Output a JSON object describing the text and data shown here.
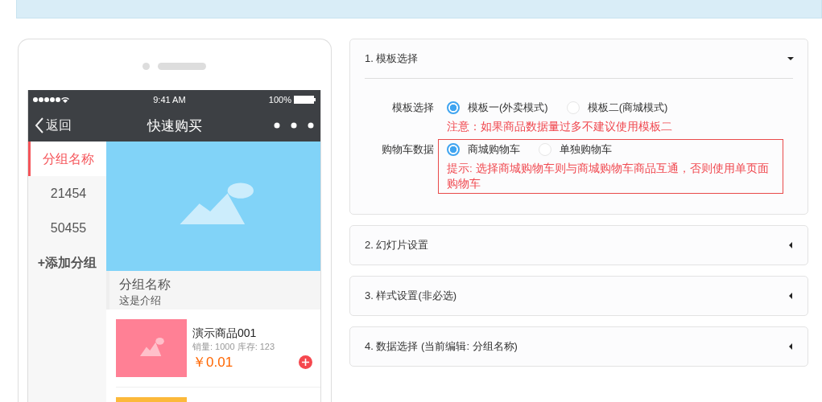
{
  "phone": {
    "status_bar": {
      "time": "9:41 AM",
      "battery": "100%"
    },
    "nav": {
      "back": "返回",
      "title": "快速购买"
    },
    "sidebar": {
      "items": [
        {
          "label": "分组名称",
          "selected": true
        },
        {
          "label": "21454",
          "selected": false
        },
        {
          "label": "50455",
          "selected": false
        }
      ],
      "add_button": "+添加分组"
    },
    "group": {
      "title": "分组名称",
      "description": "这是介绍"
    },
    "products": [
      {
        "name": "演示商品001",
        "stats": "销量: 1000 库存: 123",
        "price": "￥0.01",
        "color": "#ff8095"
      },
      {
        "color": "#fcb93a"
      }
    ]
  },
  "panels": [
    {
      "title": "1. 模板选择",
      "expanded": true,
      "fields": [
        {
          "label": "模板选择",
          "highlighted": false,
          "options": [
            {
              "label": "模板一(外卖模式)",
              "selected": true
            },
            {
              "label": "模板二(商城模式)",
              "selected": false
            }
          ],
          "note": "注意：如果商品数据量过多不建议使用模板二"
        },
        {
          "label": "购物车数据",
          "highlighted": true,
          "options": [
            {
              "label": "商城购物车",
              "selected": true
            },
            {
              "label": "单独购物车",
              "selected": false
            }
          ],
          "note": "提示: 选择商城购物车则与商城购物车商品互通，否则使用单页面购物车"
        }
      ]
    },
    {
      "title": "2. 幻灯片设置",
      "expanded": false
    },
    {
      "title": "3. 样式设置(非必选)",
      "expanded": false
    },
    {
      "title": "4. 数据选择 (当前编辑: 分组名称)",
      "expanded": false
    }
  ]
}
